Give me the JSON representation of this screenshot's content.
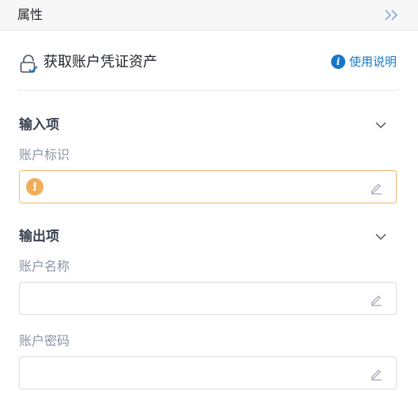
{
  "panel": {
    "title": "属性",
    "collapse_icon": "double-chevron-right-icon"
  },
  "component": {
    "title": "获取账户凭证资产",
    "icon": "lock-check-icon",
    "help": {
      "icon_text": "i",
      "label": "使用说明",
      "color": "#1677c9"
    }
  },
  "inputs": {
    "title": "输入项",
    "fields": [
      {
        "label": "账户标识",
        "value": "",
        "state": "warning",
        "warning_icon": "!"
      }
    ]
  },
  "outputs": {
    "title": "输出项",
    "fields": [
      {
        "label": "账户名称",
        "value": ""
      },
      {
        "label": "账户密码",
        "value": ""
      }
    ]
  },
  "colors": {
    "accent": "#1677c9",
    "warning": "#f2ad5b",
    "warning_border": "#f0b86a"
  }
}
